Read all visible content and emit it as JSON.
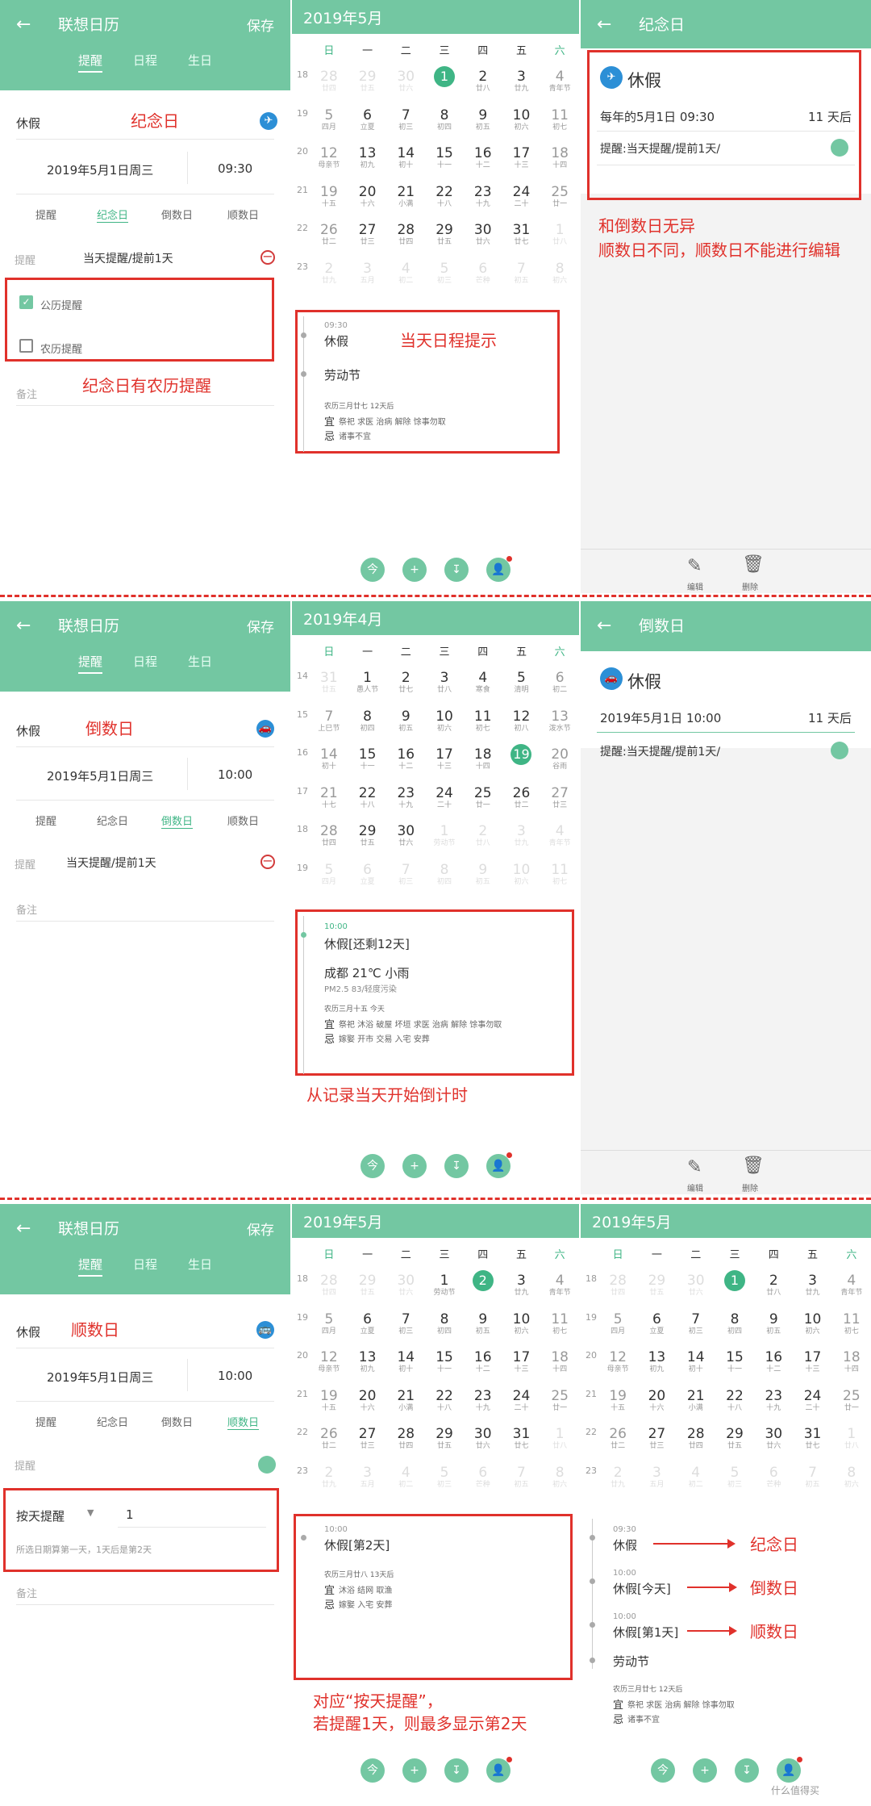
{
  "app": {
    "title": "联想日历",
    "save": "保存",
    "back": "←",
    "tabs": [
      "提醒",
      "日程",
      "生日"
    ]
  },
  "types": [
    "提醒",
    "纪念日",
    "倒数日",
    "顺数日"
  ],
  "weekdays": [
    "日",
    "一",
    "二",
    "三",
    "四",
    "五",
    "六"
  ],
  "nav": [
    "今",
    "+",
    "↧",
    "👤"
  ],
  "event_name": "休假",
  "date_text": "2019年5月1日周三",
  "row1": {
    "label": "纪念日",
    "time": "09:30",
    "remind_label": "提醒",
    "remind_value": "当天提醒/提前1天",
    "gongli": "公历提醒",
    "nongli": "农历提醒",
    "note": "备注",
    "annot": "纪念日有农历提醒",
    "month": "2019年5月",
    "ev_time": "09:30",
    "ev_name": "休假",
    "ev_holiday": "劳动节",
    "lunar": "农历三月廿七  12天后",
    "yi_label": "宜",
    "yi": "祭祀 求医 治病 解除 馀事勿取",
    "ji_label": "忌",
    "ji": "诸事不宜",
    "annot_mid": "当天日程提示",
    "detail_title": "纪念日",
    "detail_name": "休假",
    "detail_line": "每年的5月1日 09:30",
    "detail_days": "11 天后",
    "detail_remind": "提醒:当天提醒/提前1天/",
    "annot_right1": "和倒数日无异",
    "annot_right2": "顺数日不同，顺数日不能进行编辑",
    "edit": "编辑",
    "del": "删除"
  },
  "row2": {
    "label": "倒数日",
    "time": "10:00",
    "remind_label": "提醒",
    "remind_value": "当天提醒/提前1天",
    "note": "备注",
    "month": "2019年4月",
    "ev_time": "10:00",
    "ev_name": "休假[还剩12天]",
    "weather": "成都  21℃  小雨",
    "pm": "PM2.5 83/轻度污染",
    "lunar": "农历三月十五  今天",
    "yi_label": "宜",
    "yi": "祭祀 沐浴 破屋 坏垣 求医 治病 解除 馀事勿取",
    "ji_label": "忌",
    "ji": "嫁娶 开市 交易 入宅 安葬",
    "annot_mid": "从记录当天开始倒计时",
    "detail_title": "倒数日",
    "detail_name": "休假",
    "detail_line": "2019年5月1日 10:00",
    "detail_days": "11 天后",
    "detail_remind": "提醒:当天提醒/提前1天/",
    "edit": "编辑",
    "del": "删除"
  },
  "row3": {
    "label": "顺数日",
    "time": "10:00",
    "remind_label": "提醒",
    "mode": "按天提醒",
    "mode_value": "1",
    "hint": "所选日期算第一天，1天后是第2天",
    "note": "备注",
    "month": "2019年5月",
    "ev_time": "10:00",
    "ev_name": "休假[第2天]",
    "lunar": "农历三月廿八  13天后",
    "yi_label": "宜",
    "yi": "沐浴 结网 取渔",
    "ji_label": "忌",
    "ji": "嫁娶 入宅 安葬",
    "annot_mid1": "对应“按天提醒”，",
    "annot_mid2": "若提醒1天，则最多显示第2天",
    "month_r": "2019年5月",
    "list": [
      {
        "time": "09:30",
        "name": "休假",
        "tag": "纪念日"
      },
      {
        "time": "10:00",
        "name": "休假[今天]",
        "tag": "倒数日"
      },
      {
        "time": "10:00",
        "name": "休假[第1天]",
        "tag": "顺数日"
      }
    ],
    "holiday": "劳动节",
    "lunar_r": "农历三月廿七  12天后",
    "yi_r": "祭祀 求医 治病 解除 馀事勿取",
    "ji_r": "诸事不宜"
  },
  "calendars": {
    "may": {
      "weeks": [
        "18",
        "19",
        "20",
        "21",
        "22",
        "23"
      ],
      "rows": [
        [
          [
            "28",
            "廿四",
            "dim"
          ],
          [
            "29",
            "廿五",
            "dim"
          ],
          [
            "30",
            "廿六",
            "dim"
          ],
          [
            "1",
            "劳动节",
            "sel"
          ],
          [
            "2",
            "廿八",
            ""
          ],
          [
            "3",
            "廿九",
            ""
          ],
          [
            "4",
            "青年节",
            "we"
          ]
        ],
        [
          [
            "5",
            "四月",
            "we"
          ],
          [
            "6",
            "立夏",
            ""
          ],
          [
            "7",
            "初三",
            ""
          ],
          [
            "8",
            "初四",
            ""
          ],
          [
            "9",
            "初五",
            ""
          ],
          [
            "10",
            "初六",
            ""
          ],
          [
            "11",
            "初七",
            "we"
          ]
        ],
        [
          [
            "12",
            "母亲节",
            "we"
          ],
          [
            "13",
            "初九",
            ""
          ],
          [
            "14",
            "初十",
            ""
          ],
          [
            "15",
            "十一",
            ""
          ],
          [
            "16",
            "十二",
            ""
          ],
          [
            "17",
            "十三",
            ""
          ],
          [
            "18",
            "十四",
            "we"
          ]
        ],
        [
          [
            "19",
            "十五",
            "we"
          ],
          [
            "20",
            "十六",
            ""
          ],
          [
            "21",
            "小满",
            ""
          ],
          [
            "22",
            "十八",
            ""
          ],
          [
            "23",
            "十九",
            ""
          ],
          [
            "24",
            "二十",
            ""
          ],
          [
            "25",
            "廿一",
            "we"
          ]
        ],
        [
          [
            "26",
            "廿二",
            "we"
          ],
          [
            "27",
            "廿三",
            ""
          ],
          [
            "28",
            "廿四",
            ""
          ],
          [
            "29",
            "廿五",
            ""
          ],
          [
            "30",
            "廿六",
            ""
          ],
          [
            "31",
            "廿七",
            ""
          ],
          [
            "1",
            "廿八",
            "dim"
          ]
        ],
        [
          [
            "2",
            "廿九",
            "dim"
          ],
          [
            "3",
            "五月",
            "dim"
          ],
          [
            "4",
            "初二",
            "dim"
          ],
          [
            "5",
            "初三",
            "dim"
          ],
          [
            "6",
            "芒种",
            "dim"
          ],
          [
            "7",
            "初五",
            "dim"
          ],
          [
            "8",
            "初六",
            "dim"
          ]
        ]
      ]
    },
    "apr": {
      "weeks": [
        "14",
        "15",
        "16",
        "17",
        "18",
        "19"
      ],
      "rows": [
        [
          [
            "31",
            "廿五",
            "dim"
          ],
          [
            "1",
            "愚人节",
            ""
          ],
          [
            "2",
            "廿七",
            ""
          ],
          [
            "3",
            "廿八",
            ""
          ],
          [
            "4",
            "寒食",
            ""
          ],
          [
            "5",
            "清明",
            ""
          ],
          [
            "6",
            "初二",
            "we"
          ]
        ],
        [
          [
            "7",
            "上巳节",
            "we"
          ],
          [
            "8",
            "初四",
            ""
          ],
          [
            "9",
            "初五",
            ""
          ],
          [
            "10",
            "初六",
            ""
          ],
          [
            "11",
            "初七",
            ""
          ],
          [
            "12",
            "初八",
            ""
          ],
          [
            "13",
            "泼水节",
            "we"
          ]
        ],
        [
          [
            "14",
            "初十",
            "we"
          ],
          [
            "15",
            "十一",
            ""
          ],
          [
            "16",
            "十二",
            ""
          ],
          [
            "17",
            "十三",
            ""
          ],
          [
            "18",
            "十四",
            ""
          ],
          [
            "19",
            "十五",
            "sel"
          ],
          [
            "20",
            "谷雨",
            "we"
          ]
        ],
        [
          [
            "21",
            "十七",
            "we"
          ],
          [
            "22",
            "十八",
            ""
          ],
          [
            "23",
            "十九",
            ""
          ],
          [
            "24",
            "二十",
            ""
          ],
          [
            "25",
            "廿一",
            ""
          ],
          [
            "26",
            "廿二",
            ""
          ],
          [
            "27",
            "廿三",
            "we"
          ]
        ],
        [
          [
            "28",
            "廿四",
            "we"
          ],
          [
            "29",
            "廿五",
            ""
          ],
          [
            "30",
            "廿六",
            ""
          ],
          [
            "1",
            "劳动节",
            "dim"
          ],
          [
            "2",
            "廿八",
            "dim"
          ],
          [
            "3",
            "廿九",
            "dim"
          ],
          [
            "4",
            "青年节",
            "dim"
          ]
        ],
        [
          [
            "5",
            "四月",
            "dim"
          ],
          [
            "6",
            "立夏",
            "dim"
          ],
          [
            "7",
            "初三",
            "dim"
          ],
          [
            "8",
            "初四",
            "dim"
          ],
          [
            "9",
            "初五",
            "dim"
          ],
          [
            "10",
            "初六",
            "dim"
          ],
          [
            "11",
            "初七",
            "dim"
          ]
        ]
      ]
    }
  },
  "watermark": "什么值得买"
}
